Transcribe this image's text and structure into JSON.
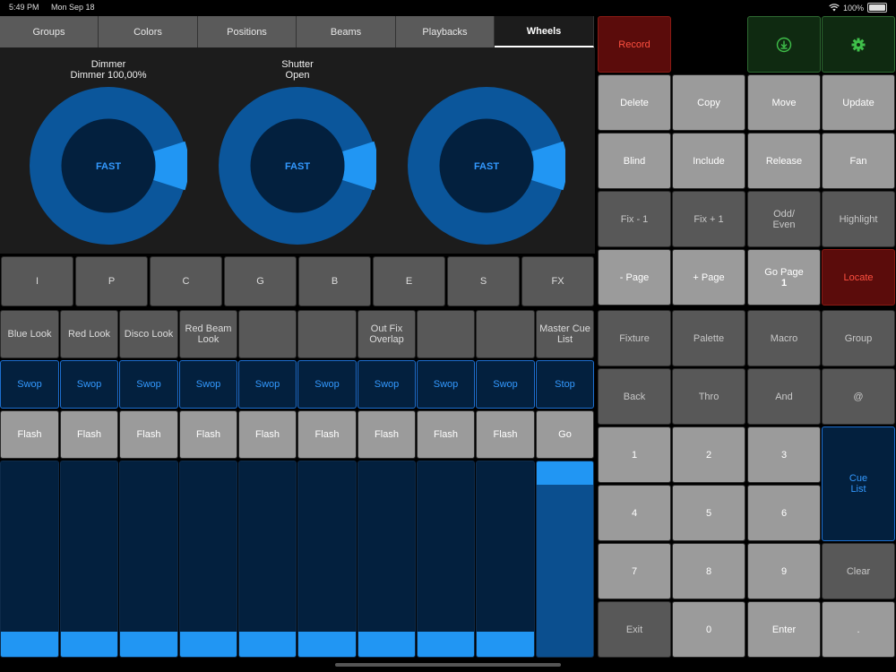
{
  "status": {
    "time": "5:49 PM",
    "date": "Mon Sep 18",
    "battery": "100%"
  },
  "tabs": [
    "Groups",
    "Colors",
    "Positions",
    "Beams",
    "Playbacks",
    "Wheels"
  ],
  "active_tab": "Wheels",
  "wheels": [
    {
      "title1": "Dimmer",
      "title2": "Dimmer 100,00%",
      "center": "FAST"
    },
    {
      "title1": "Shutter",
      "title2": "Open",
      "center": "FAST"
    },
    {
      "title1": "",
      "title2": "",
      "center": "FAST"
    }
  ],
  "attr_buttons": [
    "I",
    "P",
    "C",
    "G",
    "B",
    "E",
    "S",
    "FX"
  ],
  "playbacks": {
    "names": [
      "Blue Look",
      "Red Look",
      "Disco Look",
      "Red Beam Look",
      "",
      "",
      "Out Fix Overlap",
      "",
      "",
      "Master Cue List"
    ],
    "swop": [
      "Swop",
      "Swop",
      "Swop",
      "Swop",
      "Swop",
      "Swop",
      "Swop",
      "Swop",
      "Swop",
      "Stop"
    ],
    "flash": [
      "Flash",
      "Flash",
      "Flash",
      "Flash",
      "Flash",
      "Flash",
      "Flash",
      "Flash",
      "Flash",
      "Go"
    ]
  },
  "keypad": {
    "record": "Record",
    "row1": [
      "Delete",
      "Copy",
      "Move",
      "Update"
    ],
    "row2": [
      "Blind",
      "Include",
      "Release",
      "Fan"
    ],
    "row3": [
      "Fix - 1",
      "Fix + 1",
      "Odd/ Even",
      "Highlight"
    ],
    "row4_a": "- Page",
    "row4_b": "+ Page",
    "go_page_label": "Go Page",
    "go_page_value": "1",
    "locate": "Locate",
    "row5": [
      "Fixture",
      "Palette",
      "Macro",
      "Group"
    ],
    "row6": [
      "Back",
      "Thro",
      "And",
      "@"
    ],
    "num1": [
      "1",
      "2",
      "3"
    ],
    "num2": [
      "4",
      "5",
      "6"
    ],
    "num3": [
      "7",
      "8",
      "9"
    ],
    "cue_list": "Cue List",
    "clear": "Clear",
    "bottom": [
      "Exit",
      "0",
      "Enter",
      "."
    ]
  }
}
